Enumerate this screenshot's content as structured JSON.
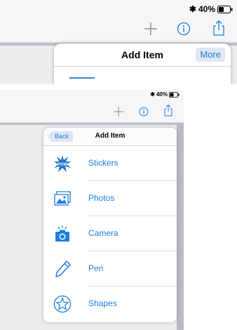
{
  "top": {
    "status": {
      "bluetooth": "✱",
      "battery_text": "40%"
    },
    "popover": {
      "title": "Add Item",
      "more_label": "More"
    }
  },
  "bottom": {
    "status": {
      "bluetooth": "✱",
      "battery_text": "40%"
    },
    "popover": {
      "title": "Add Item",
      "back_label": "Back",
      "items": [
        {
          "label": "Stickers",
          "icon": "stickers-icon"
        },
        {
          "label": "Photos",
          "icon": "photos-icon"
        },
        {
          "label": "Camera",
          "icon": "camera-icon"
        },
        {
          "label": "Pen",
          "icon": "pen-icon"
        },
        {
          "label": "Shapes",
          "icon": "shapes-icon"
        }
      ]
    }
  },
  "colors": {
    "accent": "#1e7fe0",
    "toolbar_bg": "#f6f6f8",
    "content_bg": "#ececef"
  }
}
